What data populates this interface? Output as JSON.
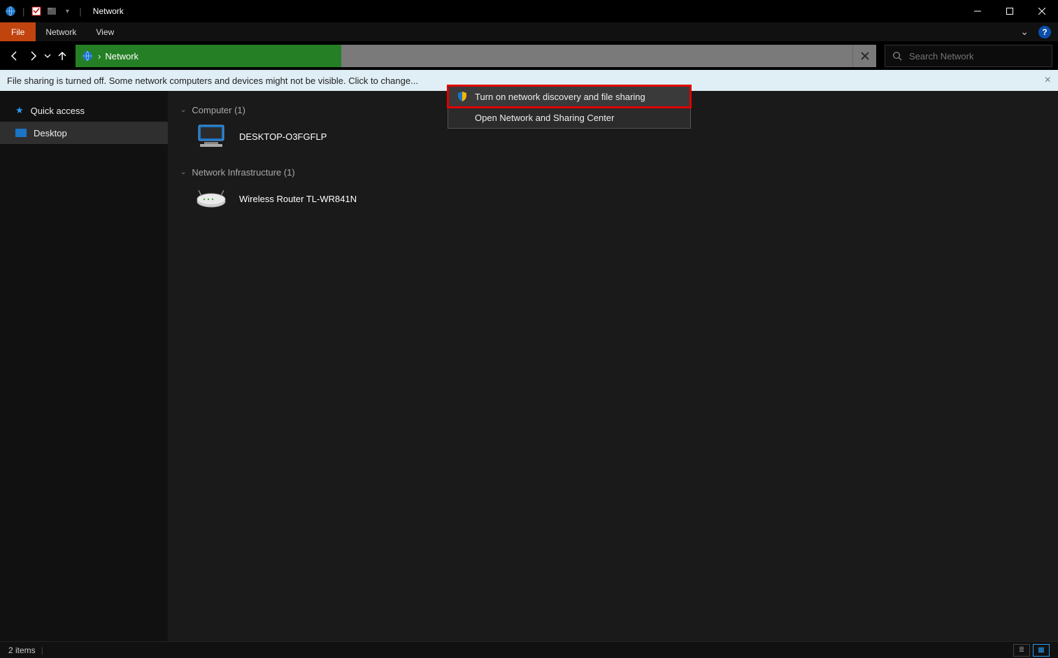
{
  "titlebar": {
    "title": "Network"
  },
  "ribbon": {
    "file": "File",
    "tabs": [
      "Network",
      "View"
    ]
  },
  "addressbar": {
    "crumb": "Network"
  },
  "search": {
    "placeholder": "Search Network"
  },
  "banner": {
    "text": "File sharing is turned off. Some network computers and devices might not be visible. Click to change..."
  },
  "context_menu": {
    "items": [
      "Turn on network discovery and file sharing",
      "Open Network and Sharing Center"
    ]
  },
  "sidebar": {
    "items": [
      {
        "label": "Quick access"
      },
      {
        "label": "Desktop"
      }
    ]
  },
  "content": {
    "groups": [
      {
        "header": "Computer (1)",
        "items": [
          {
            "label": "DESKTOP-O3FGFLP"
          }
        ]
      },
      {
        "header": "Network Infrastructure (1)",
        "items": [
          {
            "label": "Wireless Router TL-WR841N"
          }
        ]
      }
    ]
  },
  "status": {
    "text": "2 items"
  }
}
